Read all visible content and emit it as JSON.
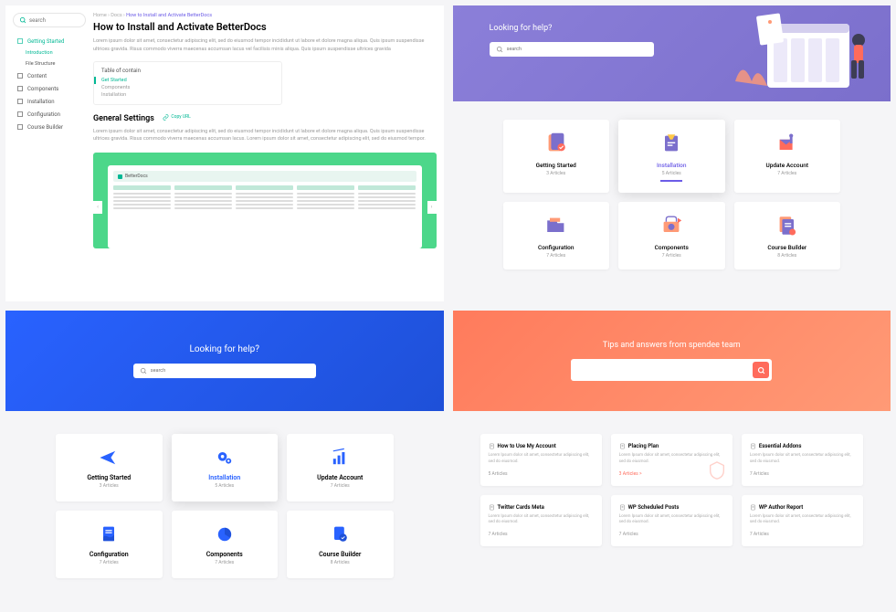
{
  "q1": {
    "search_placeholder": "search",
    "nav": [
      {
        "label": "Getting Started",
        "active": true,
        "sub": [
          {
            "label": "Introduction",
            "current": true
          },
          {
            "label": "File Structure"
          }
        ]
      },
      {
        "label": "Content"
      },
      {
        "label": "Components"
      },
      {
        "label": "Installation"
      },
      {
        "label": "Configuration"
      },
      {
        "label": "Course Builder"
      }
    ],
    "breadcrumb": {
      "parts": [
        "Home",
        "Docs"
      ],
      "current": "How to Install and Activate BetterDocs"
    },
    "title": "How to Install and Activate BetterDocs",
    "body": "Lorem ipsum dolor sit amet, consectetur adipiscing elit, sed do eiusmod tempor incididunt ut labore et dolore magna aliqua. Quis ipsum suspendisse ultrices gravida. Risus commodo viverra maecenas accumsan lacus vel facilisis minis aliqua. Quis ipsum suspendisse ultrices gravida",
    "toc": {
      "title": "Table of contain",
      "items": [
        "Get Started",
        "Components",
        "Installation"
      ]
    },
    "h2": "General Settings",
    "copy_label": "Copy URL",
    "body2": "Lorem ipsum dolor sit amet, consectetur adipiscing elit, sed do eiusmod tempor incididunt ut labore et dolore magna aliqua. Quis ipsum suspendisse ultrices gravida. Risus commodo viverra maecenas accumsan lacus. Lorem ipsum dolor sit amet, consectetur adipiscing elit, sed do eiusmod tempor.",
    "browser_title": "BetterDocs"
  },
  "q2": {
    "hero_title": "Looking for help?",
    "search_placeholder": "search",
    "cards": [
      {
        "title": "Getting Started",
        "count": "3 Articles"
      },
      {
        "title": "Installation",
        "count": "5 Articles",
        "active": true
      },
      {
        "title": "Update Account",
        "count": "7 Articles"
      },
      {
        "title": "Configuration",
        "count": "7 Articles"
      },
      {
        "title": "Components",
        "count": "7 Articles"
      },
      {
        "title": "Course Builder",
        "count": "8 Articles"
      }
    ]
  },
  "q3": {
    "hero_title": "Looking for help?",
    "search_placeholder": "search",
    "cards": [
      {
        "title": "Getting Started",
        "count": "3 Articles"
      },
      {
        "title": "Installation",
        "count": "5 Articles",
        "active": true
      },
      {
        "title": "Update Account",
        "count": "7 Articles"
      },
      {
        "title": "Configuration",
        "count": "7 Articles"
      },
      {
        "title": "Components",
        "count": "7 Articles"
      },
      {
        "title": "Course Builder",
        "count": "8 Articles"
      }
    ]
  },
  "q4": {
    "hero_title": "Tips and answers from spendee team",
    "search_placeholder": "",
    "cards": [
      {
        "title": "How to Use My Account",
        "body": "Lorem Ipsum dolor sit amet, consectetur adipiscing elit, sed do eiusmod.",
        "count": "5 Articles"
      },
      {
        "title": "Placing Plan",
        "body": "Lorem Ipsum dolor sit amet, consectetur adipiscing elit, sed do eiusmod.",
        "count": "3 Articles >",
        "active": true
      },
      {
        "title": "Essential Addons",
        "body": "Lorem Ipsum dolor sit amet, consectetur adipiscing elit, sed do eiusmod.",
        "count": "7 Articles"
      },
      {
        "title": "Twitter Cards Meta",
        "body": "Lorem Ipsum dolor sit amet, consectetur adipiscing elit, sed do eiusmod.",
        "count": "7 Articles"
      },
      {
        "title": "WP Scheduled Posts",
        "body": "Lorem Ipsum dolor sit amet, consectetur adipiscing elit, sed do eiusmod.",
        "count": "7 Articles"
      },
      {
        "title": "WP Author Report",
        "body": "Lorem Ipsum dolor sit amet, consectetur adipiscing elit, sed do eiusmod.",
        "count": "7 Articles"
      }
    ]
  }
}
